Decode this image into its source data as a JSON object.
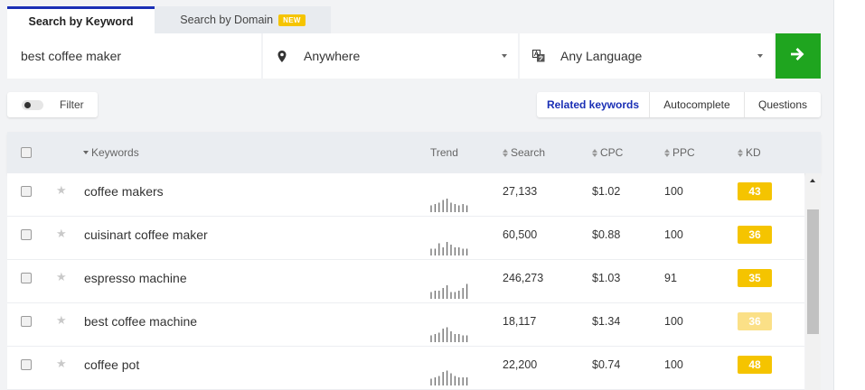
{
  "tabs": [
    {
      "label": "Search by Keyword",
      "active": true
    },
    {
      "label": "Search by Domain",
      "badge": "NEW",
      "active": false
    }
  ],
  "search": {
    "value": "best coffee maker",
    "location": "Anywhere",
    "language": "Any Language"
  },
  "filter": {
    "label": "Filter",
    "enabled": false
  },
  "views": [
    "Related keywords",
    "Autocomplete",
    "Questions"
  ],
  "table": {
    "headers": {
      "keywords": "Keywords",
      "trend": "Trend",
      "search": "Search",
      "cpc": "CPC",
      "ppc": "PPC",
      "kd": "KD"
    },
    "rows": [
      {
        "keyword": "coffee makers",
        "search": "27,133",
        "cpc": "$1.02",
        "ppc": "100",
        "kd": "43",
        "kd_color": "#f5c400",
        "trend": [
          5,
          6,
          7,
          9,
          10,
          7,
          6,
          5,
          6,
          5
        ]
      },
      {
        "keyword": "cuisinart coffee maker",
        "search": "60,500",
        "cpc": "$0.88",
        "ppc": "100",
        "kd": "36",
        "kd_color": "#f5c400",
        "trend": [
          5,
          5,
          9,
          6,
          10,
          8,
          6,
          6,
          5,
          5
        ]
      },
      {
        "keyword": "espresso machine",
        "search": "246,273",
        "cpc": "$1.03",
        "ppc": "91",
        "kd": "35",
        "kd_color": "#f5c400",
        "trend": [
          5,
          6,
          6,
          8,
          10,
          5,
          5,
          6,
          8,
          11
        ]
      },
      {
        "keyword": "best coffee machine",
        "search": "18,117",
        "cpc": "$1.34",
        "ppc": "100",
        "kd": "36",
        "kd_color": "#fbe087",
        "trend": [
          5,
          6,
          7,
          10,
          11,
          8,
          6,
          6,
          5,
          5
        ]
      },
      {
        "keyword": "coffee pot",
        "search": "22,200",
        "cpc": "$0.74",
        "ppc": "100",
        "kd": "48",
        "kd_color": "#f5c400",
        "trend": [
          5,
          6,
          7,
          10,
          11,
          9,
          7,
          6,
          6,
          6
        ]
      }
    ]
  },
  "colors": {
    "accent": "#1a2fb5",
    "go": "#1fa51f",
    "kd": "#f5c400"
  }
}
